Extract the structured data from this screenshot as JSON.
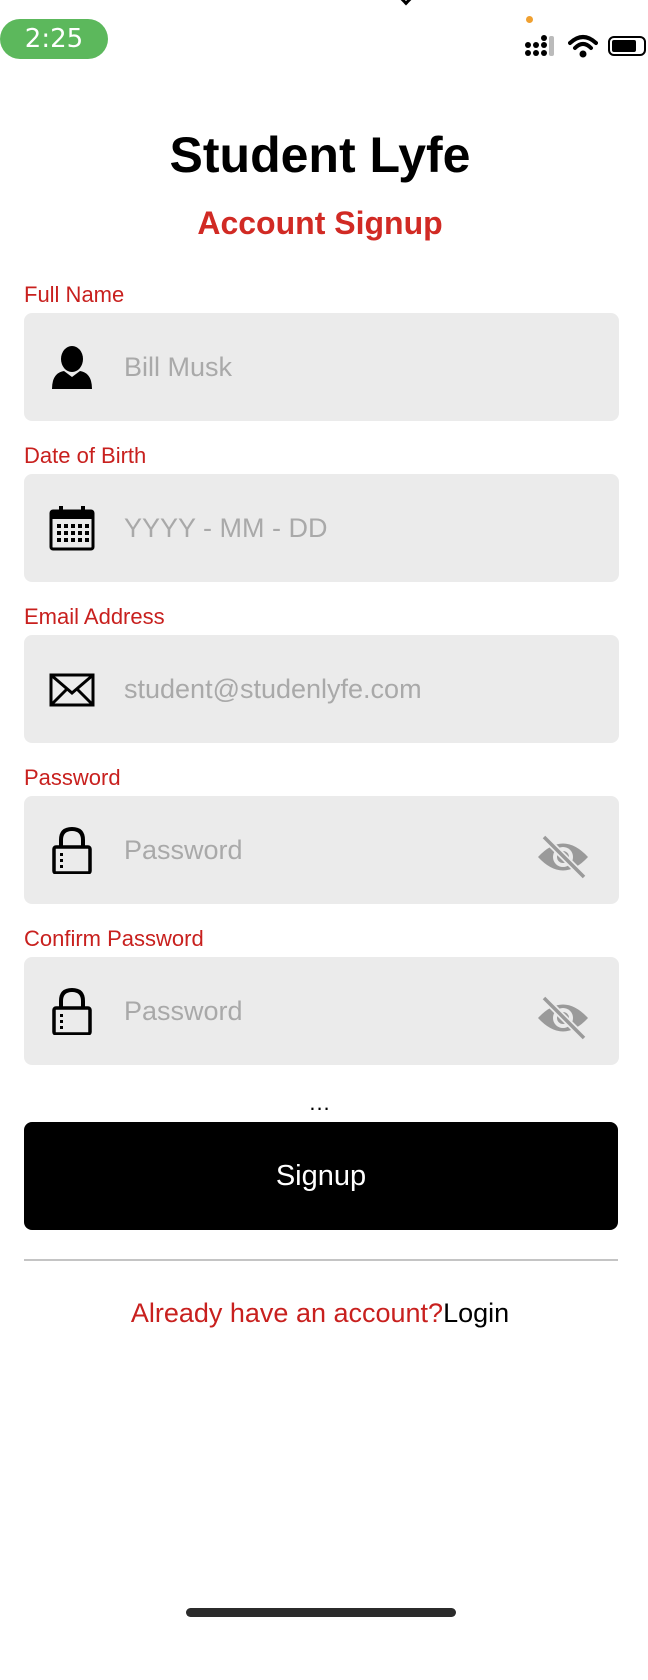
{
  "status_bar": {
    "time": "2:25",
    "icons": [
      "cellular-signal-icon",
      "wifi-icon",
      "battery-icon"
    ],
    "time_pill_color": "#5cb85c"
  },
  "header": {
    "title": "Student Lyfe",
    "subtitle": "Account Signup"
  },
  "form": {
    "fields": [
      {
        "label": "Full Name",
        "placeholder": "Bill Musk",
        "value": "",
        "icon": "person-icon"
      },
      {
        "label": "Date of Birth",
        "placeholder": "YYYY - MM - DD",
        "value": "",
        "icon": "calendar-icon"
      },
      {
        "label": "Email Address",
        "placeholder": "student@studenlyfe.com",
        "value": "",
        "icon": "envelope-icon"
      },
      {
        "label": "Password",
        "placeholder": "Password",
        "value": "",
        "icon": "lock-icon",
        "toggle_icon": "eye-slash-icon"
      },
      {
        "label": "Confirm Password",
        "placeholder": "Password",
        "value": "",
        "icon": "lock-icon",
        "toggle_icon": "eye-slash-icon"
      }
    ],
    "ellipsis": "...",
    "submit_label": "Signup"
  },
  "footer": {
    "prompt": "Already have an account?",
    "login_label": "Login"
  },
  "colors": {
    "accent": "#c8201e",
    "field_background": "#ebebeb",
    "button_background": "#000000"
  }
}
